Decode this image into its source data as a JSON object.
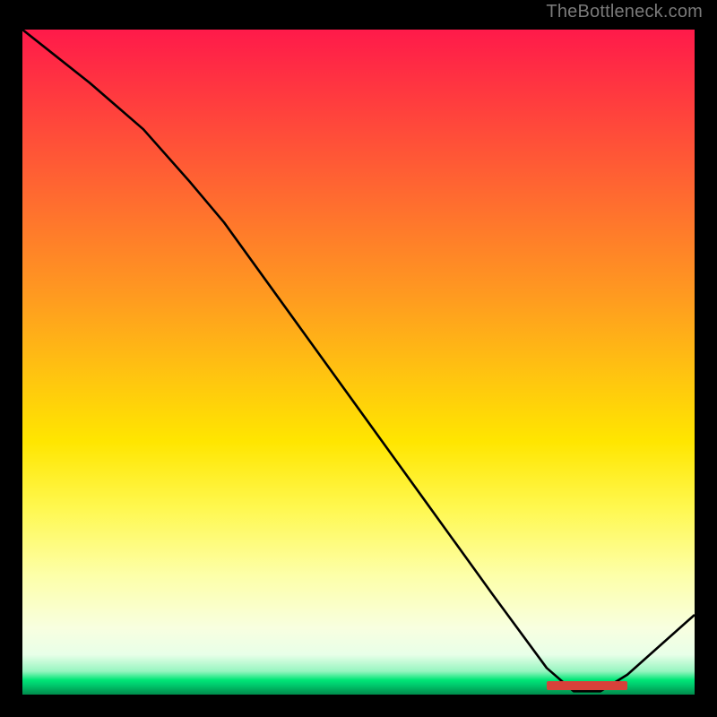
{
  "attribution": "TheBottleneck.com",
  "chart_data": {
    "type": "line",
    "title": "",
    "xlabel": "",
    "ylabel": "",
    "xlim": [
      0,
      100
    ],
    "ylim": [
      0,
      100
    ],
    "series": [
      {
        "name": "curve",
        "x": [
          0,
          5,
          10,
          18,
          25,
          30,
          40,
          50,
          60,
          70,
          78,
          82,
          86,
          90,
          100
        ],
        "y": [
          100,
          96,
          92,
          85,
          77,
          71,
          57,
          43,
          29,
          15,
          4,
          0.5,
          0.5,
          3,
          12
        ]
      }
    ],
    "marker": {
      "x_start": 78,
      "x_end": 90,
      "y": 1.4,
      "label": ""
    },
    "background": "red-yellow-green vertical gradient (red top, green bottom)"
  }
}
